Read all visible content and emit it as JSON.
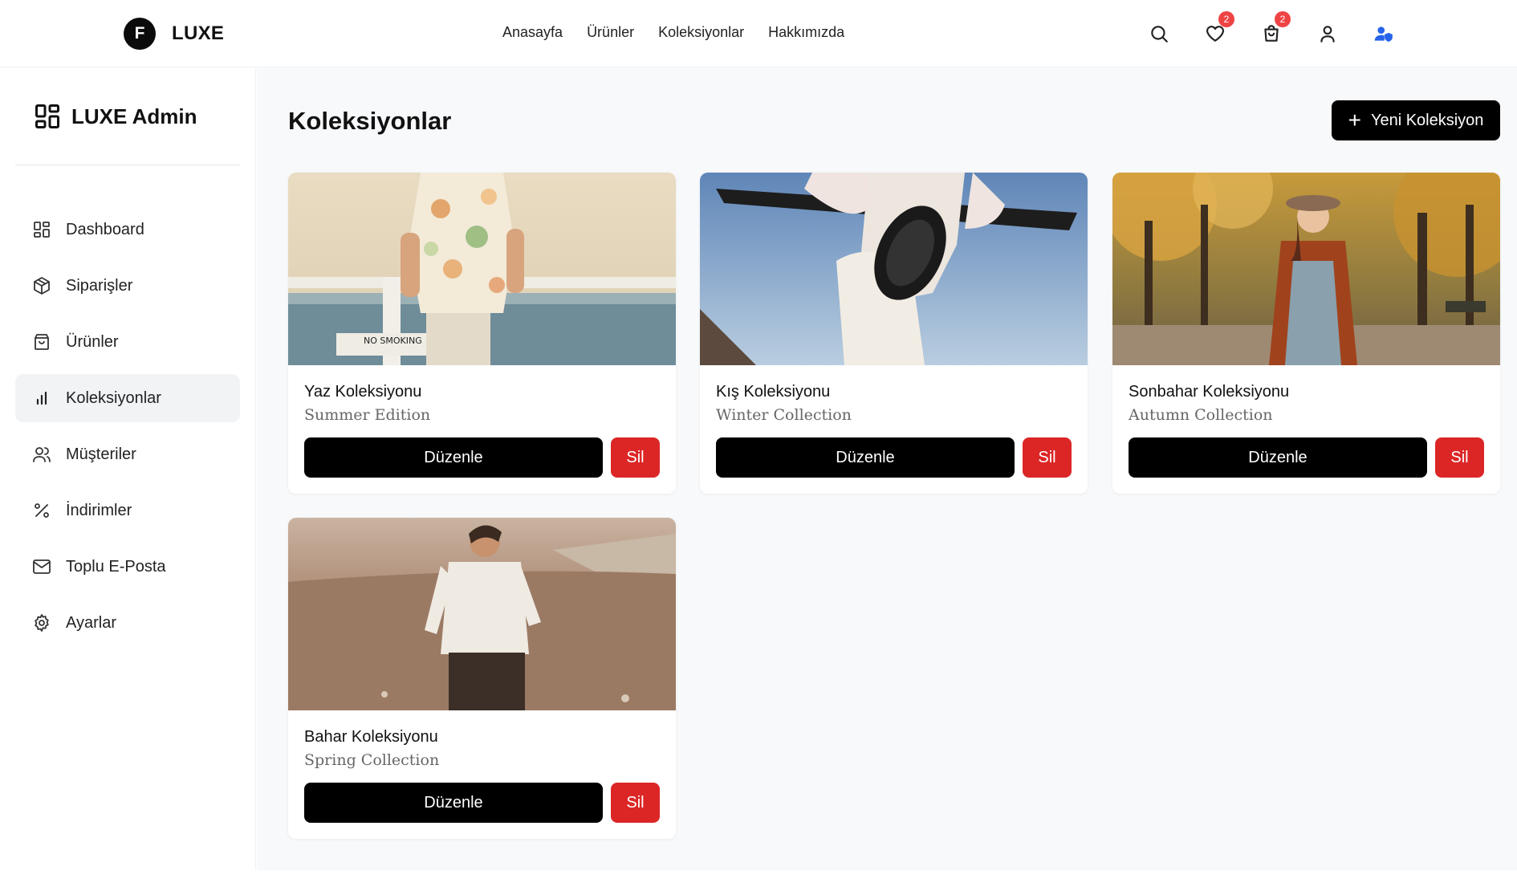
{
  "brand": {
    "badge": "F",
    "name": "LUXE"
  },
  "nav": [
    "Anasayfa",
    "Ürünler",
    "Koleksiyonlar",
    "Hakkımızda"
  ],
  "top_icons": {
    "favorites_count": "2",
    "cart_count": "2"
  },
  "sidebar": {
    "title": "LUXE Admin",
    "items": [
      {
        "label": "Dashboard",
        "icon": "dashboard-icon"
      },
      {
        "label": "Siparişler",
        "icon": "box-icon"
      },
      {
        "label": "Ürünler",
        "icon": "shopping-bag-icon"
      },
      {
        "label": "Koleksiyonlar",
        "icon": "bar-chart-icon",
        "active": true
      },
      {
        "label": "Müşteriler",
        "icon": "users-icon"
      },
      {
        "label": "İndirimler",
        "icon": "percent-icon"
      },
      {
        "label": "Toplu E-Posta",
        "icon": "mail-icon"
      },
      {
        "label": "Ayarlar",
        "icon": "gear-icon"
      }
    ]
  },
  "main": {
    "title": "Koleksiyonlar",
    "new_button": "Yeni Koleksiyon",
    "collections": [
      {
        "title": "Yaz Koleksiyonu",
        "subtitle": "Summer Edition",
        "edit": "Düzenle",
        "delete": "Sil",
        "image_text": "NO SMOKING"
      },
      {
        "title": "Kış Koleksiyonu",
        "subtitle": "Winter Collection",
        "edit": "Düzenle",
        "delete": "Sil"
      },
      {
        "title": "Sonbahar Koleksiyonu",
        "subtitle": "Autumn Collection",
        "edit": "Düzenle",
        "delete": "Sil"
      },
      {
        "title": "Bahar Koleksiyonu",
        "subtitle": "Spring Collection",
        "edit": "Düzenle",
        "delete": "Sil"
      }
    ]
  },
  "colors": {
    "accent": "#000000",
    "danger": "#dc2626",
    "badge": "#ef4444",
    "admin_icon": "#2563eb"
  }
}
